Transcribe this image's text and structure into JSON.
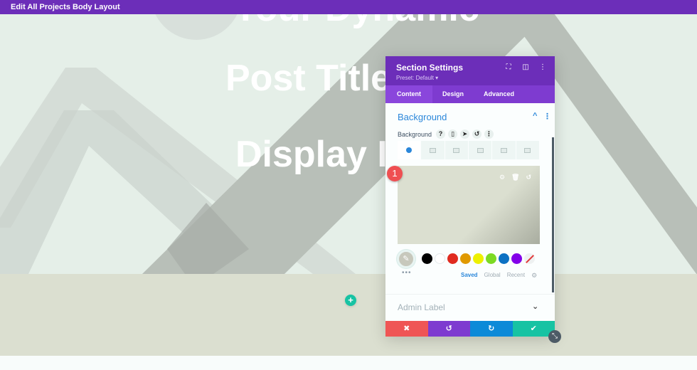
{
  "topbar": {
    "title": "Edit All Projects Body Layout"
  },
  "page": {
    "headings": [
      "Your Dynamic",
      "Post Title",
      "Display I"
    ],
    "add_button_icon": "plus-icon",
    "colors": {
      "hero_bg": "#e5efe8",
      "lower_bg": "#dbdfd0",
      "shape_gray": "#b8bfb8",
      "add_button": "#17c3a3"
    }
  },
  "modal": {
    "title": "Section Settings",
    "preset": "Preset: Default ▾",
    "header_icons": [
      "fullscreen-icon",
      "sidebar-icon",
      "more-icon"
    ],
    "tabs": [
      {
        "label": "Content",
        "active": true
      },
      {
        "label": "Design",
        "active": false
      },
      {
        "label": "Advanced",
        "active": false
      }
    ],
    "section": {
      "title": "Background",
      "field_label": "Background",
      "field_icons": [
        "help-icon",
        "responsive-icon",
        "hover-icon",
        "reset-icon",
        "more-icon"
      ],
      "bg_type_tabs": [
        "color",
        "gradient",
        "image",
        "video",
        "pattern",
        "mask"
      ],
      "active_bg_type": "color",
      "preview_color": "#dbdfd0",
      "preview_icons": [
        "settings-icon",
        "trash-icon",
        "reset-icon"
      ],
      "badge": "1"
    },
    "palette": {
      "swatches": [
        "#000000",
        "#ffffff",
        "#e02b20",
        "#e09900",
        "#edf000",
        "#7cda24",
        "#0c71c3",
        "#8300e9",
        "none"
      ],
      "tabs": [
        {
          "label": "Saved",
          "active": true
        },
        {
          "label": "Global",
          "active": false
        },
        {
          "label": "Recent",
          "active": false
        }
      ]
    },
    "admin_label": "Admin Label",
    "footer": {
      "cancel": "✖",
      "undo": "↺",
      "redo": "↻",
      "save": "✔",
      "colors": {
        "cancel": "#ef5555",
        "undo": "#7e3bd0",
        "redo": "#0c8ad8",
        "save": "#17c3a3"
      }
    }
  }
}
